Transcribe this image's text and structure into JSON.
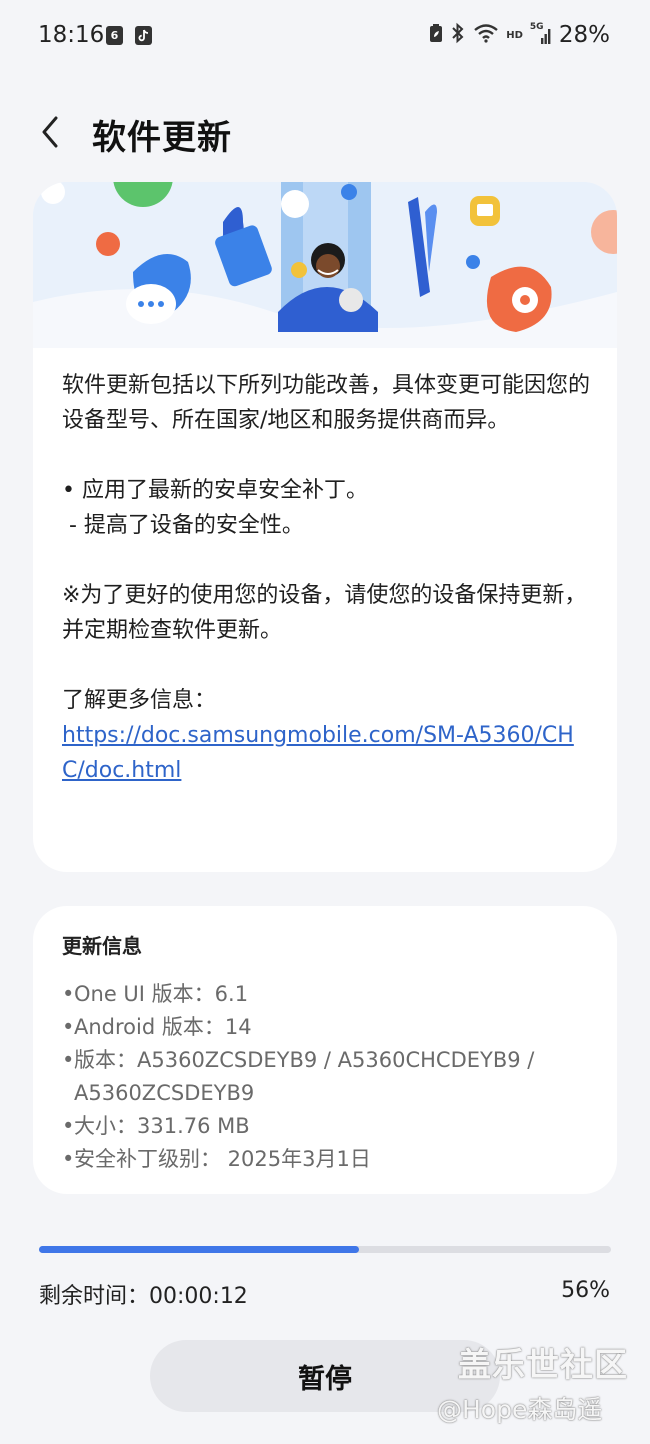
{
  "status_bar": {
    "time": "18:16",
    "left_icons": [
      "calendar-6-icon",
      "tiktok-icon"
    ],
    "calendar_day": "6",
    "right_icons": [
      "battery-saver-icon",
      "bluetooth-icon",
      "wifi-icon",
      "hd-icon",
      "5g-signal-icon"
    ],
    "hd_label": "HD",
    "network_label": "5G",
    "battery": "28%"
  },
  "header": {
    "back_icon": "chevron-left-icon",
    "title": "软件更新"
  },
  "release_notes": {
    "intro": "软件更新包括以下所列功能改善，具体变更可能因您的设备型号、所在国家/地区和服务提供商而异。",
    "item_1": "• 应用了最新的安卓安全补丁。",
    "item_1_sub": " - 提高了设备的安全性。",
    "note": "※为了更好的使用您的设备，请使您的设备保持更新，并定期检查软件更新。",
    "more_info_label": "了解更多信息：",
    "link": "https://doc.samsungmobile.com/SM-A5360/CHC/doc.html"
  },
  "update_info": {
    "title": "更新信息",
    "items": [
      "One UI 版本：6.1",
      "Android 版本：14",
      "版本：A5360ZCSDEYB9 / A5360CHCDEYB9 / A5360ZCSDEYB9",
      "大小：331.76 MB",
      "安全补丁级别： 2025年3月1日"
    ]
  },
  "progress": {
    "value_percent": 56,
    "remaining_time": "剩余时间：00:00:12",
    "percent_label": "56%"
  },
  "pause_button": "暂停",
  "watermark": {
    "line1": "盖乐世社区",
    "line2": "@Hope森岛遥"
  },
  "colors": {
    "accent": "#3f76e8",
    "link": "#2e64c9",
    "background": "#f4f5f8",
    "card": "#ffffff"
  }
}
